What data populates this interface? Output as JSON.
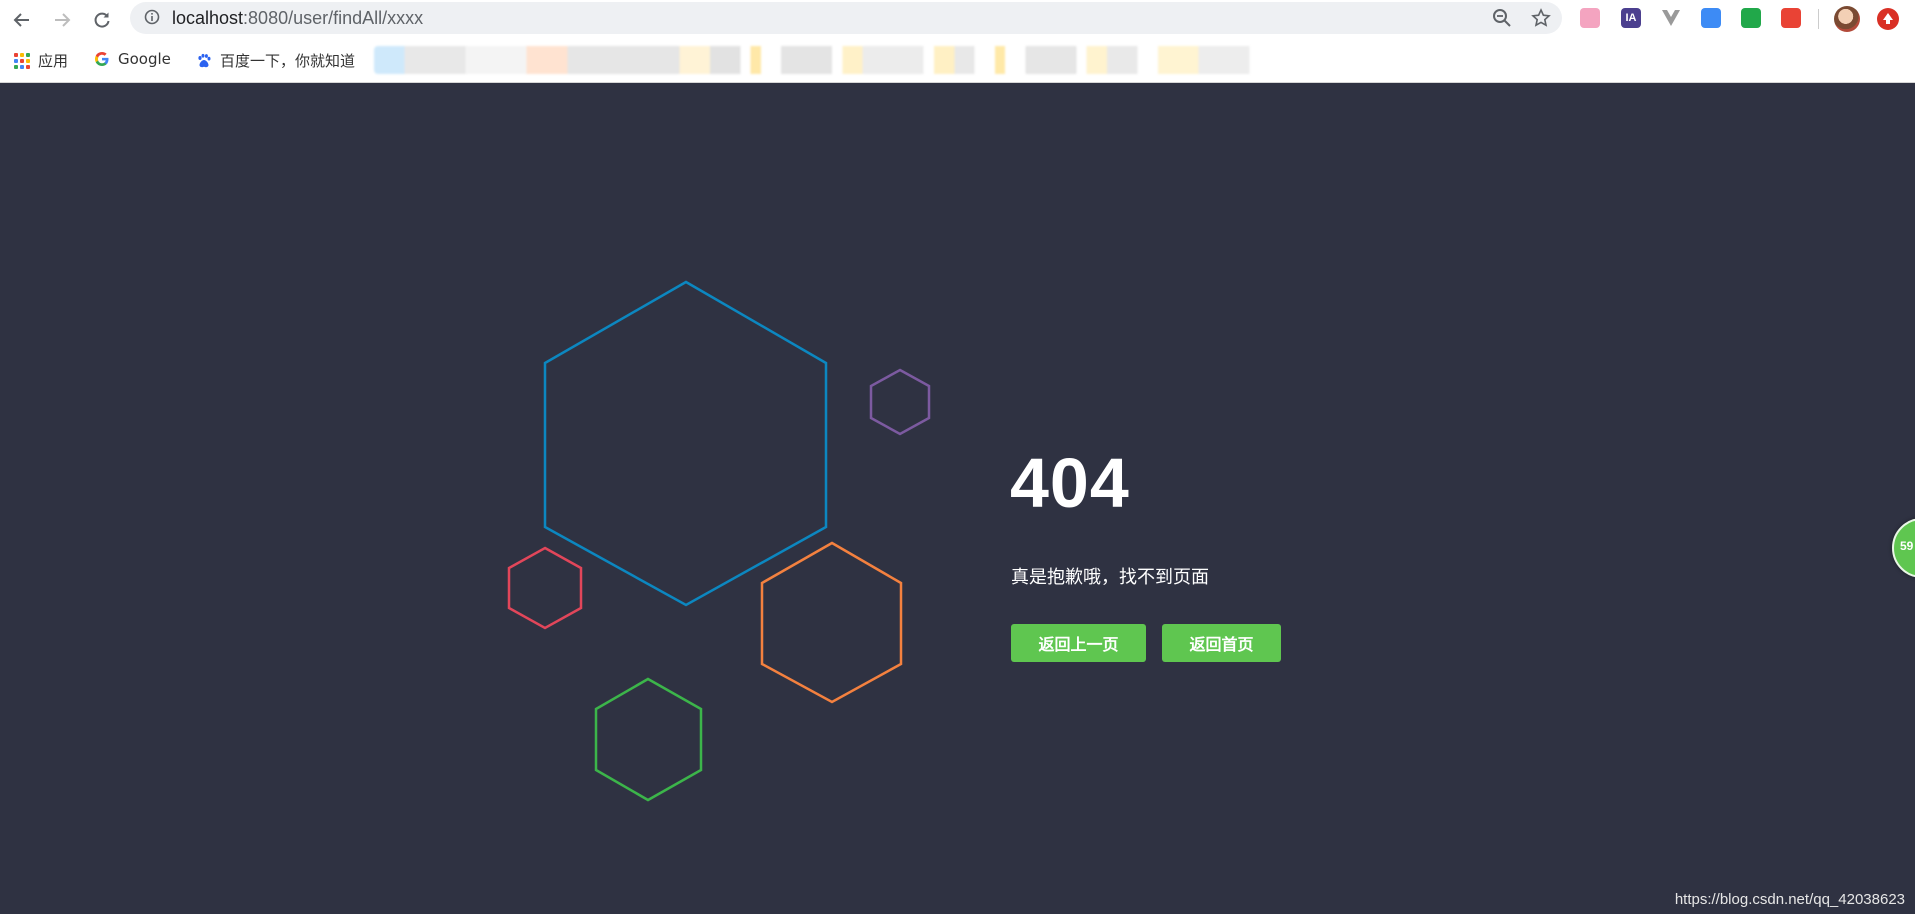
{
  "browser": {
    "url_host": "localhost",
    "url_path": ":8080/user/findAll/xxxx",
    "bookmarks": [
      {
        "label": "应用",
        "icon": "apps-grid-icon"
      },
      {
        "label": "Google",
        "icon": "google-icon"
      },
      {
        "label": "百度一下，你就知道",
        "icon": "baidu-paw-icon"
      }
    ],
    "extensions": [
      {
        "icon": "pink-extension-icon",
        "text": "",
        "color": "#f4a4c0"
      },
      {
        "icon": "ia-extension-icon",
        "text": "IA",
        "color": "#4b3f8f"
      },
      {
        "icon": "vue-devtools-icon",
        "text": "",
        "color": "#a0a0a0"
      },
      {
        "icon": "blue-pen-extension-icon",
        "text": "",
        "color": "#3d8bf5"
      },
      {
        "icon": "shield-extension-icon",
        "text": "",
        "color": "#21a84a"
      },
      {
        "icon": "colorful-extension-icon",
        "text": "",
        "color": "#e94335"
      }
    ]
  },
  "error_page": {
    "title": "404",
    "message": "真是抱歉哦，找不到页面",
    "back_button": "返回上一页",
    "home_button": "返回首页",
    "hexagon_colors": {
      "large": "#0c87c0",
      "purple": "#7c5aa0",
      "red": "#e2465a",
      "orange": "#f4813f",
      "green": "#3cb54a"
    }
  },
  "floating_badge": "59",
  "watermark": "https://blog.csdn.net/qq_42038623"
}
